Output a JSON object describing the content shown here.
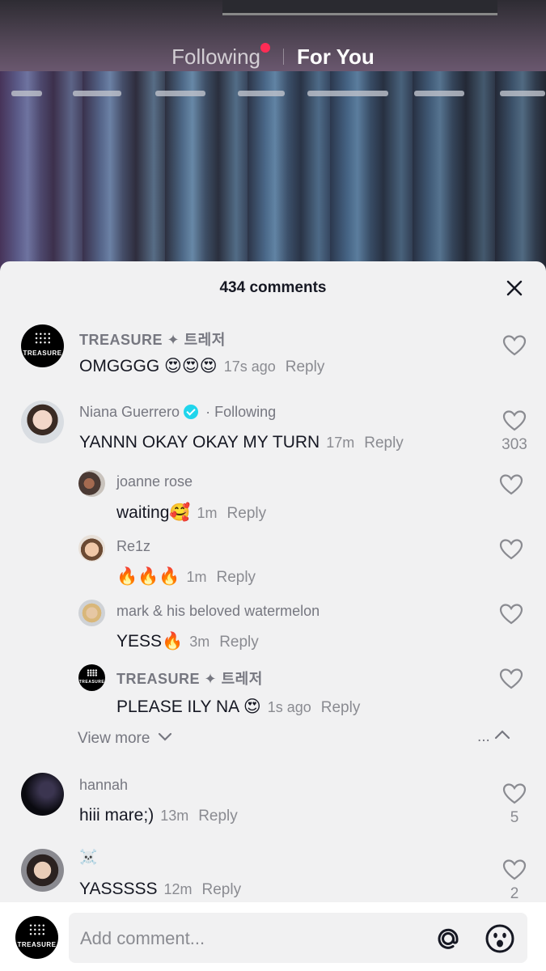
{
  "top_nav": {
    "following_label": "Following",
    "for_you_label": "For You"
  },
  "comments_header": {
    "count_label": "434 comments"
  },
  "comments": [
    {
      "user": "TREASURE ✦ 트레저",
      "text": "OMGGGG 😍😍😍",
      "time": "17s ago",
      "reply": "Reply",
      "likes": ""
    },
    {
      "user": "Niana Guerrero",
      "following": "· Following",
      "text": "YANNN OKAY OKAY MY TURN",
      "time": "17m",
      "reply": "Reply",
      "likes": "303"
    },
    {
      "user": "joanne rose",
      "text": "waiting🥰",
      "time": "1m",
      "reply": "Reply",
      "likes": ""
    },
    {
      "user": "Re1z",
      "text": "🔥🔥🔥",
      "time": "1m",
      "reply": "Reply",
      "likes": ""
    },
    {
      "user": "mark & his beloved watermelon",
      "text": "YESS🔥",
      "time": "3m",
      "reply": "Reply",
      "likes": ""
    },
    {
      "user": "TREASURE ✦ 트레저",
      "text": "PLEASE ILY NA 😍",
      "time": "1s ago",
      "reply": "Reply",
      "likes": ""
    },
    {
      "user": "hannah",
      "text": "hiii mare;)",
      "time": "13m",
      "reply": "Reply",
      "likes": "5"
    },
    {
      "user": "☠️",
      "text": "YASSSSS",
      "time": "12m",
      "reply": "Reply",
      "likes": "2"
    }
  ],
  "replies_controls": {
    "view_more_label": "View more",
    "collapse_label": "..."
  },
  "composer": {
    "placeholder": "Add comment..."
  },
  "colors": {
    "accent": "#fe2c55",
    "verified": "#20d5ec",
    "sheet_bg": "#f1f1f2"
  }
}
